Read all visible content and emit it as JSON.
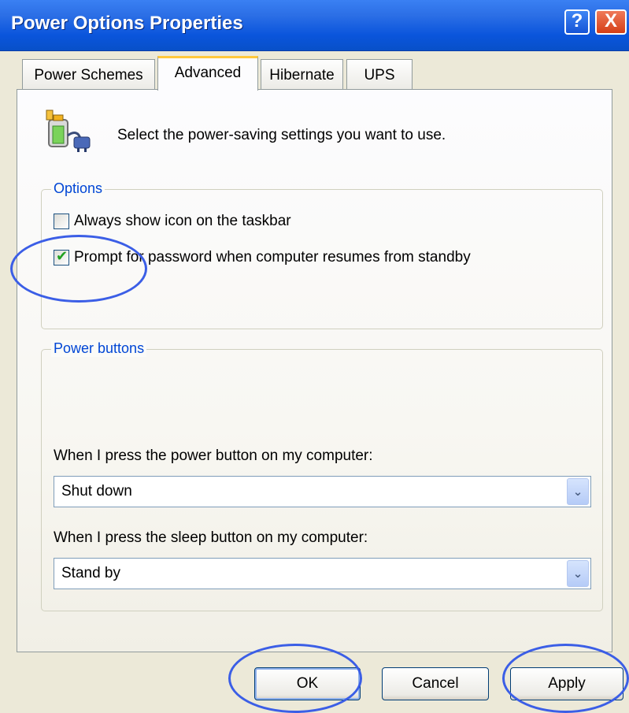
{
  "window": {
    "title": "Power Options Properties",
    "help_label": "?",
    "close_label": "X"
  },
  "tabs": [
    {
      "label": "Power Schemes",
      "active": false
    },
    {
      "label": "Advanced",
      "active": true
    },
    {
      "label": "Hibernate",
      "active": false
    },
    {
      "label": "UPS",
      "active": false
    }
  ],
  "header": {
    "icon": "power-meter-plug-icon",
    "text": "Select the power-saving settings you want to use."
  },
  "options": {
    "legend": "Options",
    "items": [
      {
        "label": "Always show icon on the taskbar",
        "checked": false
      },
      {
        "label": "Prompt for password when computer resumes from standby",
        "checked": true
      }
    ]
  },
  "power_buttons": {
    "legend": "Power buttons",
    "power_label": "When I press the power button on my computer:",
    "power_value": "Shut down",
    "sleep_label": "When I press the sleep button on my computer:",
    "sleep_value": "Stand by"
  },
  "buttons": {
    "ok": "OK",
    "cancel": "Cancel",
    "apply": "Apply"
  },
  "colors": {
    "accent": "#0a55dc",
    "legend": "#0046d5",
    "annotation": "#3b5ee6"
  }
}
